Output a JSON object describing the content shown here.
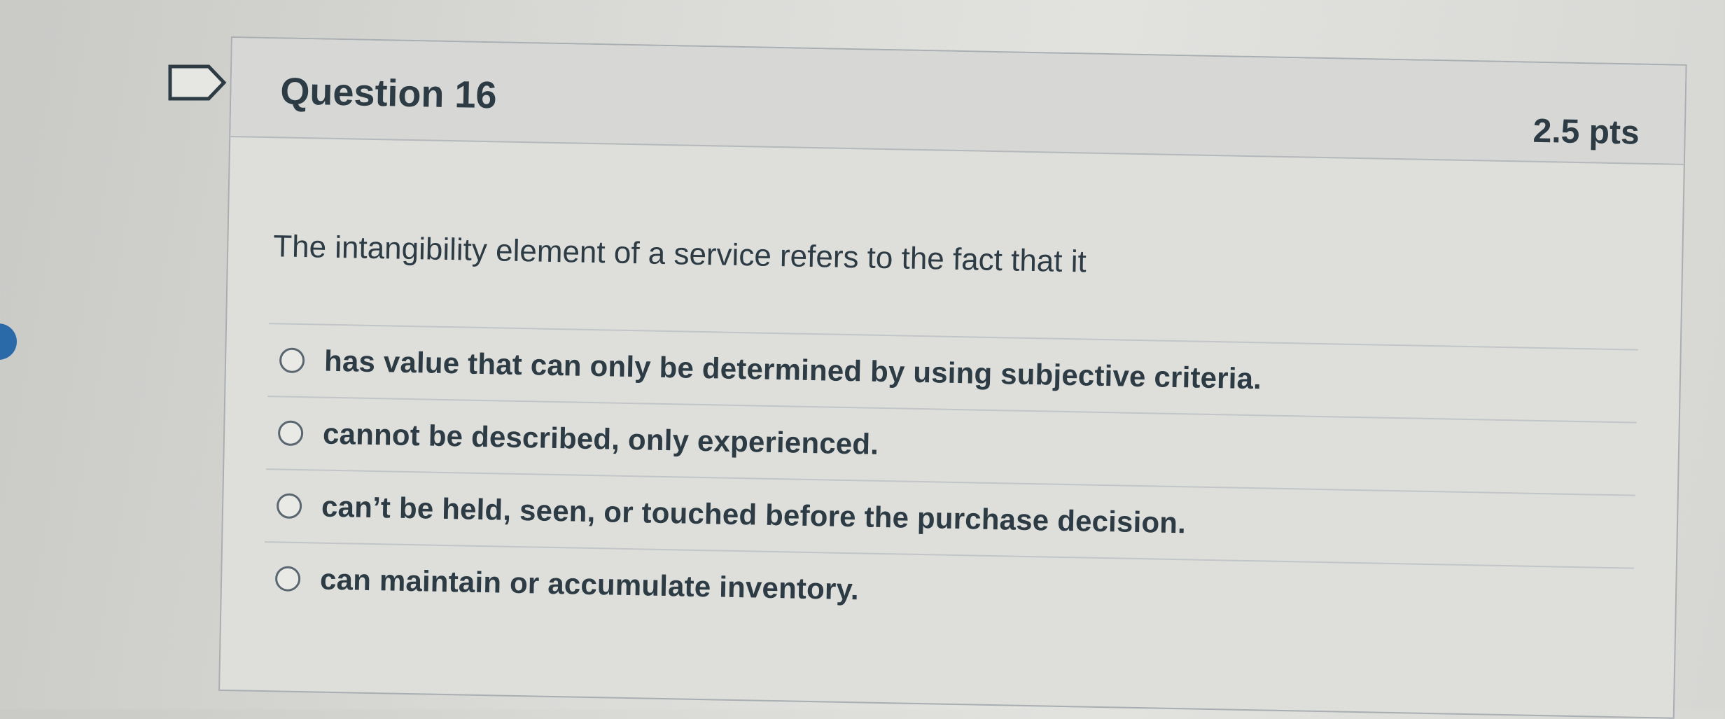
{
  "question": {
    "title": "Question 16",
    "points": "2.5 pts",
    "text": "The intangibility element of a service refers to the fact that it"
  },
  "icons": {
    "flag": "flag-outline-icon",
    "radio": "radio-unchecked-icon"
  },
  "answers": [
    {
      "label": "has value that can only be determined by using subjective criteria."
    },
    {
      "label": "cannot be described, only experienced."
    },
    {
      "label": "can’t be held, seen, or touched before the purchase decision."
    },
    {
      "label": "can maintain or accumulate inventory."
    }
  ]
}
